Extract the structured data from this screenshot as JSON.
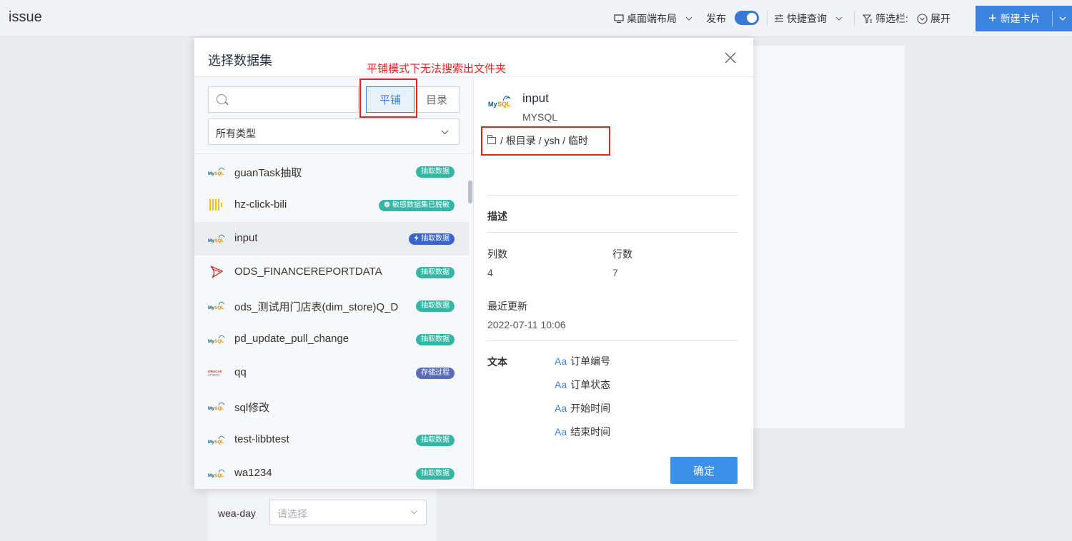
{
  "header": {
    "title": "issue",
    "layout_label": "桌面端布局",
    "publish_label": "发布",
    "publish_on": true,
    "quick_query_label": "快捷查询",
    "filter_bar_label": "筛选栏:",
    "expand_label": "展开",
    "new_card_label": "新建卡片"
  },
  "background": {
    "filter_label": "wea-day",
    "filter_placeholder": "请选择"
  },
  "modal": {
    "title": "选择数据集",
    "search_placeholder": "",
    "tab_flat": "平铺",
    "tab_directory": "目录",
    "type_select": "所有类型",
    "datasets": [
      {
        "name": "guanTask抽取",
        "icon": "mysql-icon",
        "badge": "抽取数据",
        "badge_style": "teal"
      },
      {
        "name": "hz-click-bili",
        "icon": "clickhouse-icon",
        "badge": "敏感数据集已脱敏",
        "badge_style": "teal",
        "badge_icon": "shield-icon"
      },
      {
        "name": "input",
        "icon": "mysql-icon",
        "badge": "抽取数据",
        "badge_style": "blue",
        "badge_icon": "bolt-icon",
        "selected": true
      },
      {
        "name": "ODS_FINANCEREPORTDATA",
        "icon": "sqlserver-icon",
        "badge": "抽取数据",
        "badge_style": "teal"
      },
      {
        "name": "ods_测试用门店表(dim_store)Q_D",
        "icon": "mysql-icon",
        "badge": "抽取数据",
        "badge_style": "teal"
      },
      {
        "name": "pd_update_pull_change",
        "icon": "mysql-icon",
        "badge": "抽取数据",
        "badge_style": "teal"
      },
      {
        "name": "qq",
        "icon": "oracle-icon",
        "badge": "存储过程",
        "badge_style": "purple"
      },
      {
        "name": "sql修改",
        "icon": "mysql-icon",
        "badge": "",
        "badge_style": ""
      },
      {
        "name": "test-libbtest",
        "icon": "mysql-icon",
        "badge": "抽取数据",
        "badge_style": "teal"
      },
      {
        "name": "wa1234",
        "icon": "mysql-icon",
        "badge": "抽取数据",
        "badge_style": "teal"
      }
    ],
    "detail": {
      "name": "input",
      "db_type": "MYSQL",
      "path": "/ 根目录 / ysh / 临时",
      "description_label": "描述",
      "columns_label": "列数",
      "columns_value": "4",
      "rows_label": "行数",
      "rows_value": "7",
      "updated_label": "最近更新",
      "updated_value": "2022-07-11 10:06",
      "text_label": "文本",
      "fields": [
        "订单编号",
        "订单状态",
        "开始时间",
        "结束时间"
      ],
      "field_prefix": "Aa"
    },
    "confirm_label": "确定"
  },
  "annotation": {
    "note": "平铺模式下无法搜索出文件夹",
    "color": "#e8231d"
  },
  "colors": {
    "accent": "#3b84e0",
    "badge_teal": "#35b6a4",
    "badge_blue": "#3a64c8",
    "badge_purple": "#5b6bb8"
  }
}
